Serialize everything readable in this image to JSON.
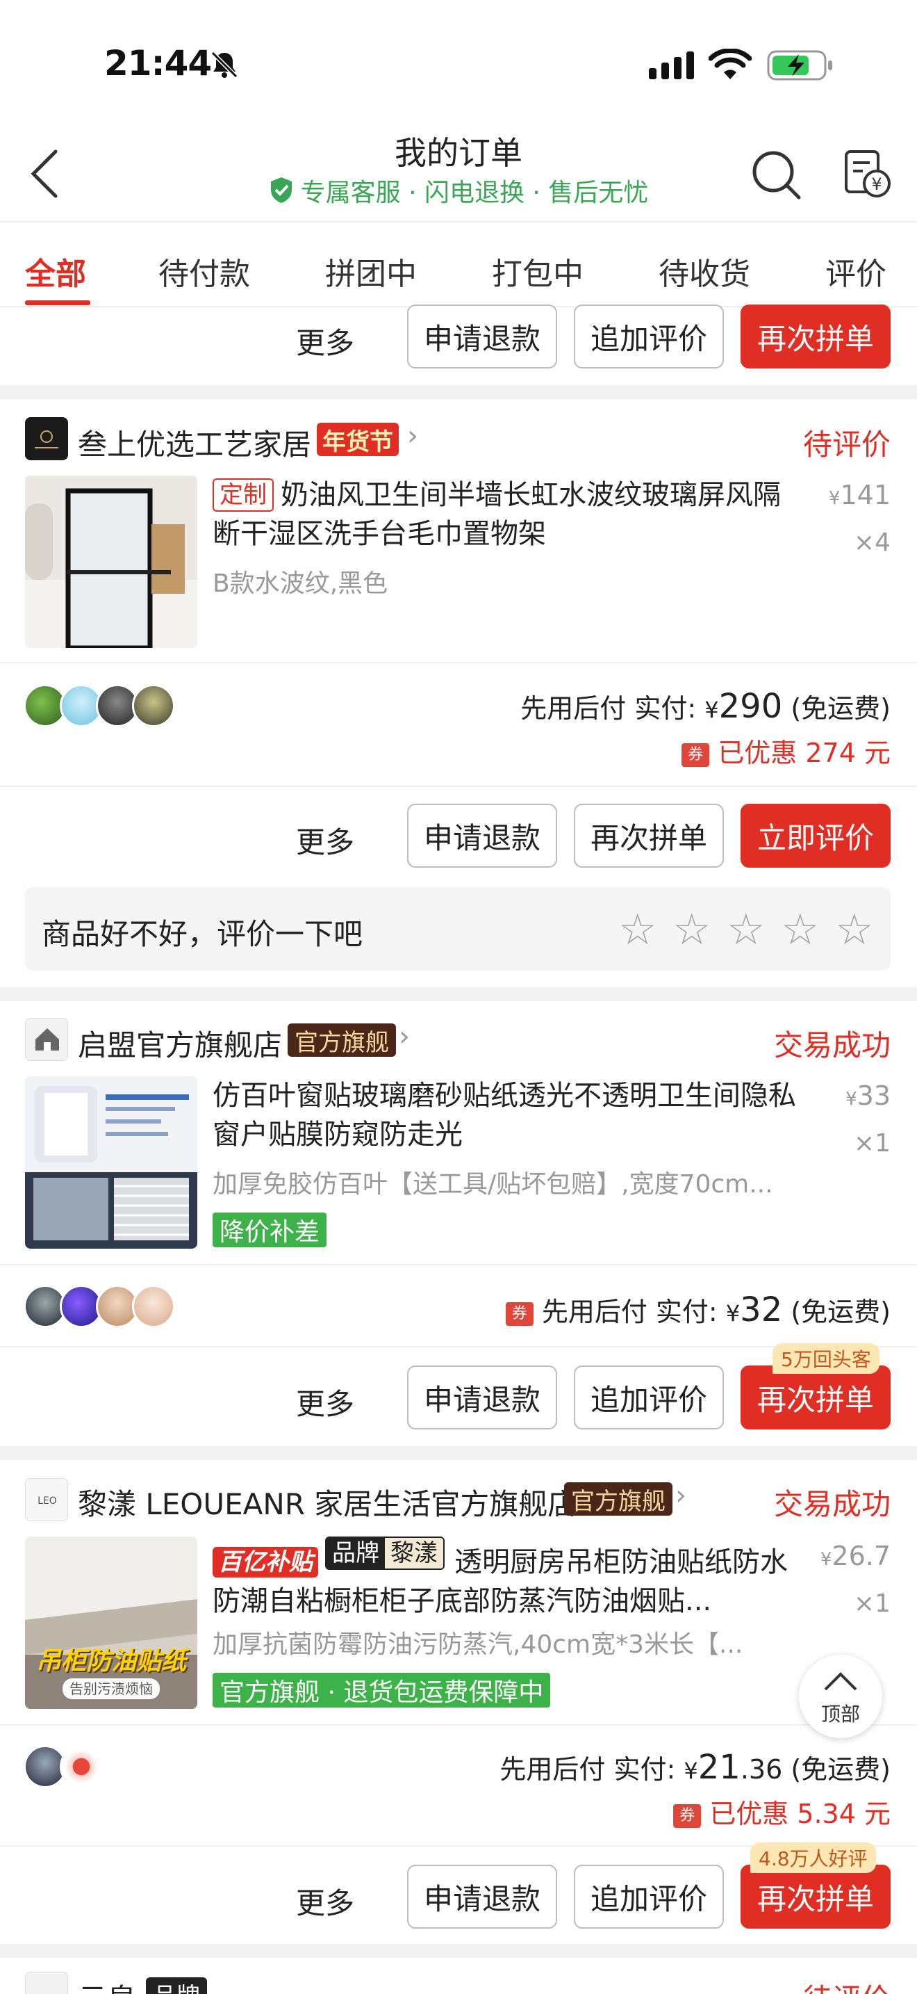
{
  "status_bar": {
    "time": "21:44"
  },
  "header": {
    "title": "我的订单",
    "subtitle": "专属客服 · 闪电退换 · 售后无忧"
  },
  "tabs": [
    "全部",
    "待付款",
    "拼团中",
    "打包中",
    "待收货",
    "评价"
  ],
  "common": {
    "more": "更多",
    "refund": "申请退款",
    "add_review": "追加评价",
    "reorder": "再次拼单",
    "review_now": "立即评价"
  },
  "orders": [
    {
      "shop": "叁上优选工艺家居",
      "shop_tag": "年货节",
      "status": "待评价",
      "product": {
        "custom_tag": "定制",
        "title": "奶油风卫生间半墙长虹水波纹玻璃屏风隔断干湿区洗手台毛巾置物架",
        "spec": "B款水波纹,黑色",
        "price": "141",
        "qty": "×4"
      },
      "pay": {
        "prefix": "先用后付  实付: ",
        "yen": "¥",
        "amount": "290",
        "suffix": "(免运费)"
      },
      "discount": "已优惠 274 元",
      "review_prompt": "商品好不好，评价一下吧"
    },
    {
      "shop": "启盟官方旗舰店",
      "shop_tag": "官方旗舰",
      "status": "交易成功",
      "product": {
        "title": "仿百叶窗贴玻璃磨砂贴纸透光不透明卫生间隐私窗户贴膜防窥防走光",
        "spec": "加厚免胶仿百叶【送工具/贴坏包赔】,宽度70cm...",
        "price": "33",
        "qty": "×1",
        "green_tag": "降价补差"
      },
      "pay": {
        "prefix": "先用后付  实付: ",
        "yen": "¥",
        "amount": "32",
        "suffix": "(免运费)"
      },
      "promo_badge": "5万回头客"
    },
    {
      "shop": "黎漾 LEOUEANR 家居生活官方旗舰店",
      "shop_tag": "官方旗舰",
      "status": "交易成功",
      "product": {
        "tag_subsidy": "百亿补贴",
        "tag_brand": "品牌",
        "tag_brand_name": "黎漾",
        "title": "透明厨房吊柜防油贴纸防水防潮自粘橱柜柜子底部防蒸汽防油烟贴...",
        "spec": "加厚抗菌防霉防油污防蒸汽,40cm宽*3米长【...",
        "price": "26.7",
        "qty": "×1",
        "green_tag": "官方旗舰 · 退货包运费保障中",
        "thumb_text": "吊柜防油贴纸",
        "thumb_sub": "告别污渍烦恼"
      },
      "pay": {
        "prefix": "先用后付  实付: ",
        "yen": "¥",
        "amount": "21",
        "amount_dec": ".36",
        "suffix": "(免运费)"
      },
      "discount": "已优惠 5.34 元",
      "promo_badge": "4.8万人好评"
    },
    {
      "shop": "云帛",
      "shop_tag": "品牌",
      "status": "待评价"
    }
  ],
  "to_top": "顶部",
  "colors": {
    "accent": "#e02e24",
    "green": "#3db249",
    "subtitle_green": "#3aa655"
  }
}
